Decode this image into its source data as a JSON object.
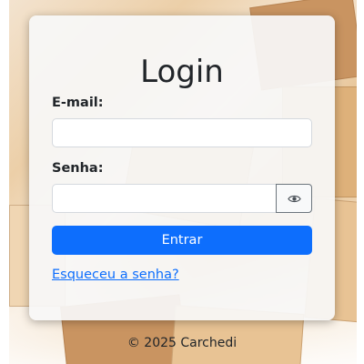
{
  "login": {
    "title": "Login",
    "email_label": "E-mail:",
    "email_value": "",
    "email_placeholder": "",
    "password_label": "Senha:",
    "password_value": "",
    "password_placeholder": "",
    "toggle_icon": "eye-icon",
    "submit_label": "Entrar",
    "forgot_link": "Esqueceu a senha?"
  },
  "footer": {
    "text": "© 2025 Carchedi"
  },
  "colors": {
    "primary": "#0d6efd",
    "card_background": "#f8f8f8",
    "text": "#212529"
  }
}
